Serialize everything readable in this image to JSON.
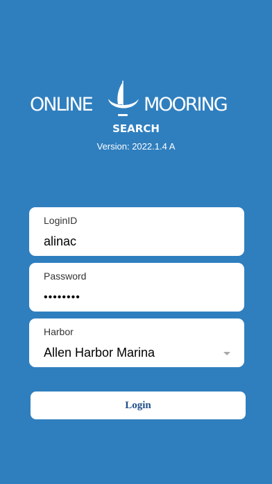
{
  "logo": {
    "left_word": "ONLINE",
    "right_word": "MOORING",
    "icon": "sailboat-icon"
  },
  "subtitle": "SEARCH",
  "version": "Version: 2022.1.4 A",
  "form": {
    "login_label": "LoginID",
    "login_value": "alinac",
    "password_label": "Password",
    "password_value": "••••••••",
    "harbor_label": "Harbor",
    "harbor_value": "Allen Harbor Marina"
  },
  "login_button": "Login",
  "colors": {
    "background": "#2f7fbf",
    "button_text": "#1f4f8a"
  }
}
